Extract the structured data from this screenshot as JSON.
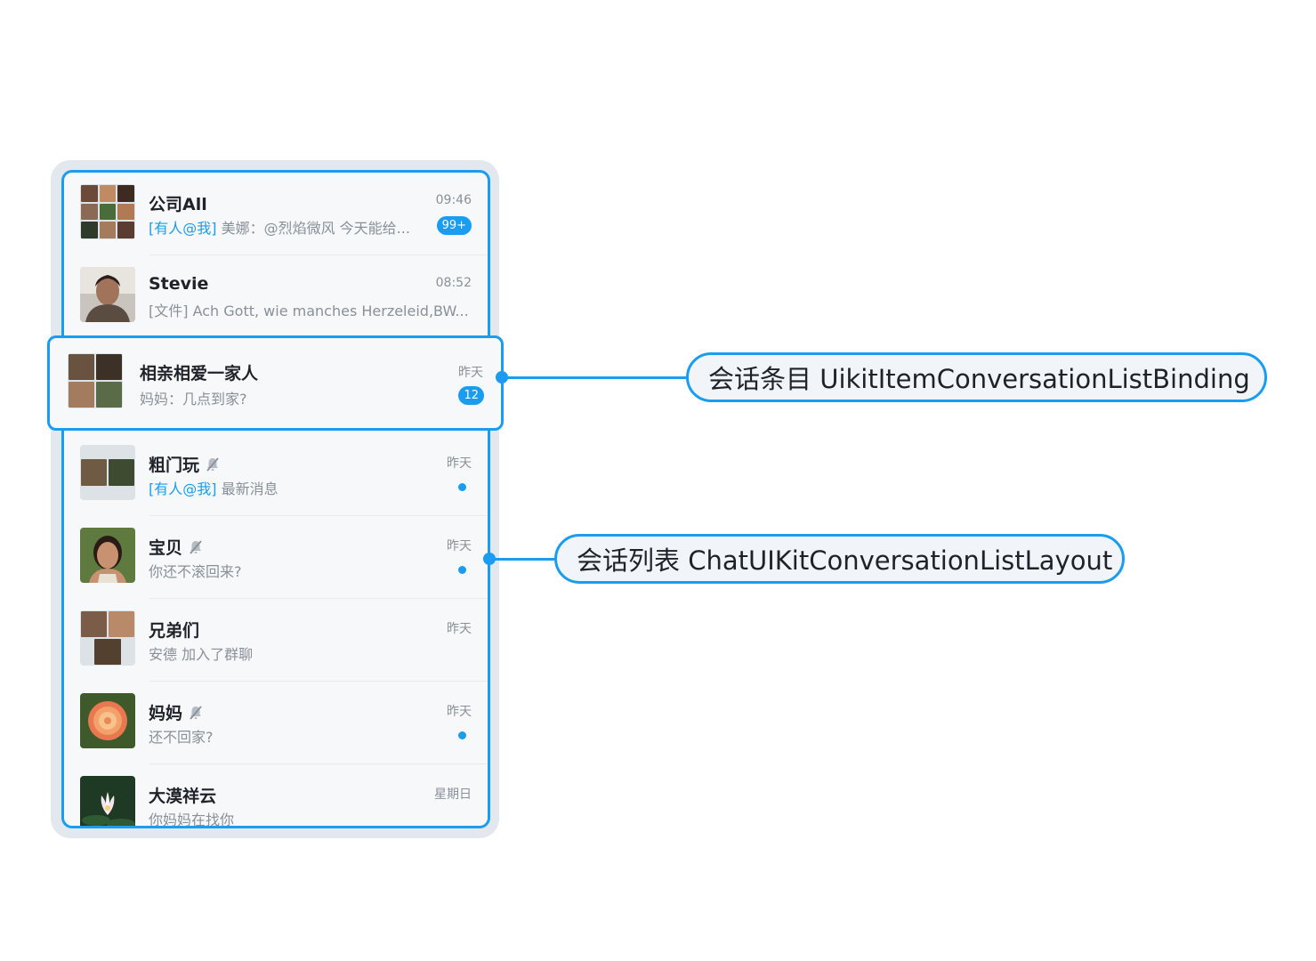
{
  "conversations": [
    {
      "name": "公司All",
      "time": "09:46",
      "mention": "[有人@我]",
      "preview": " 美娜：@烈焰微风 今天能给...",
      "badge": "99+",
      "muted": false,
      "avatar": "group-9"
    },
    {
      "name": "Stevie",
      "time": "08:52",
      "mention": "",
      "preview": "[文件] Ach Gott, wie manches Herzeleid,BW...",
      "badge": "",
      "muted": false,
      "avatar": "portrait-man"
    },
    {
      "name": "相亲相爱一家人",
      "time": "昨天",
      "mention": "",
      "preview": "妈妈：几点到家?",
      "badge": "12",
      "muted": false,
      "avatar": "group-4"
    },
    {
      "name": "粗门玩",
      "time": "昨天",
      "mention": "[有人@我]",
      "preview": " 最新消息",
      "badge": "",
      "muted": true,
      "avatar": "group-2"
    },
    {
      "name": "宝贝",
      "time": "昨天",
      "mention": "",
      "preview": "你还不滚回来?",
      "badge": "",
      "muted": true,
      "avatar": "portrait-woman"
    },
    {
      "name": "兄弟们",
      "time": "昨天",
      "mention": "",
      "preview": "安德 加入了群聊",
      "badge": "",
      "muted": false,
      "avatar": "group-3"
    },
    {
      "name": "妈妈",
      "time": "昨天",
      "mention": "",
      "preview": "还不回家?",
      "badge": "",
      "muted": true,
      "avatar": "flower-rose"
    },
    {
      "name": "大漠祥云",
      "time": "星期日",
      "mention": "",
      "preview": "你妈妈在找你",
      "badge": "",
      "muted": false,
      "avatar": "flower-lotus"
    }
  ],
  "callouts": {
    "item": "会话条目 UikitItemConversationListBinding",
    "list": "会话列表 ChatUIKitConversationListLayout"
  },
  "icons": {
    "mute": "bell-off-icon"
  },
  "colors": {
    "accent": "#1a9cf0",
    "frame": "#e3e8ee",
    "background": "#f6f8f9",
    "text_secondary": "#8a9099"
  }
}
